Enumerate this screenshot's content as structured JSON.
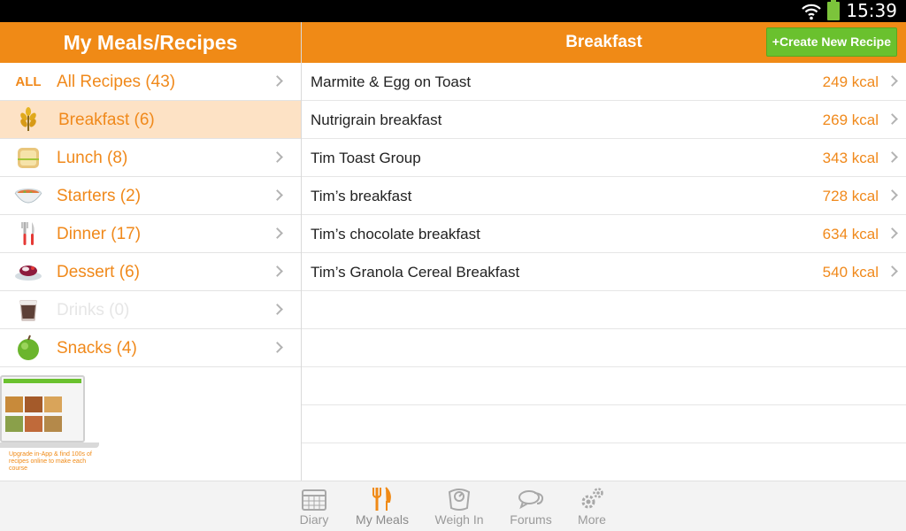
{
  "status_bar": {
    "time": "15:39"
  },
  "left_panel": {
    "title": "My Meals/Recipes",
    "categories": [
      {
        "icon": "all-text-icon",
        "icon_text": "ALL",
        "label": "All Recipes (43)",
        "selected": false,
        "disabled": false
      },
      {
        "icon": "wheat-icon",
        "label": "Breakfast (6)",
        "selected": true,
        "disabled": false
      },
      {
        "icon": "sandwich-icon",
        "label": "Lunch (8)",
        "selected": false,
        "disabled": false
      },
      {
        "icon": "soup-bowl-icon",
        "label": "Starters (2)",
        "selected": false,
        "disabled": false
      },
      {
        "icon": "fork-knife-icon",
        "label": "Dinner (17)",
        "selected": false,
        "disabled": false
      },
      {
        "icon": "dessert-icon",
        "label": "Dessert (6)",
        "selected": false,
        "disabled": false
      },
      {
        "icon": "coffee-cup-icon",
        "label": "Drinks (0)",
        "selected": false,
        "disabled": true
      },
      {
        "icon": "apple-icon",
        "label": "Snacks (4)",
        "selected": false,
        "disabled": false
      }
    ],
    "promo": {
      "text": "Upgrade in-App & find 100s of recipes online to make each course"
    }
  },
  "right_panel": {
    "title": "Breakfast",
    "create_button": "+Create New Recipe",
    "recipes": [
      {
        "name": "Marmite & Egg on Toast",
        "kcal": "249 kcal"
      },
      {
        "name": "Nutrigrain breakfast",
        "kcal": "269 kcal"
      },
      {
        "name": "Tim Toast Group",
        "kcal": "343 kcal"
      },
      {
        "name": "Tim’s breakfast",
        "kcal": "728 kcal"
      },
      {
        "name": "Tim’s chocolate breakfast",
        "kcal": "634 kcal"
      },
      {
        "name": "Tim’s Granola Cereal Breakfast",
        "kcal": "540 kcal"
      }
    ]
  },
  "bottom_nav": [
    {
      "icon": "calendar-icon",
      "label": "Diary",
      "active": false
    },
    {
      "icon": "fork-knife-icon",
      "label": "My Meals",
      "active": true
    },
    {
      "icon": "scale-icon",
      "label": "Weigh In",
      "active": false
    },
    {
      "icon": "chat-bubbles-icon",
      "label": "Forums",
      "active": false
    },
    {
      "icon": "gears-icon",
      "label": "More",
      "active": false
    }
  ],
  "colors": {
    "brand_orange": "#f08a16",
    "selected_row": "#fde2c5",
    "create_green": "#6ac12e",
    "kcal_text": "#f0891b"
  }
}
